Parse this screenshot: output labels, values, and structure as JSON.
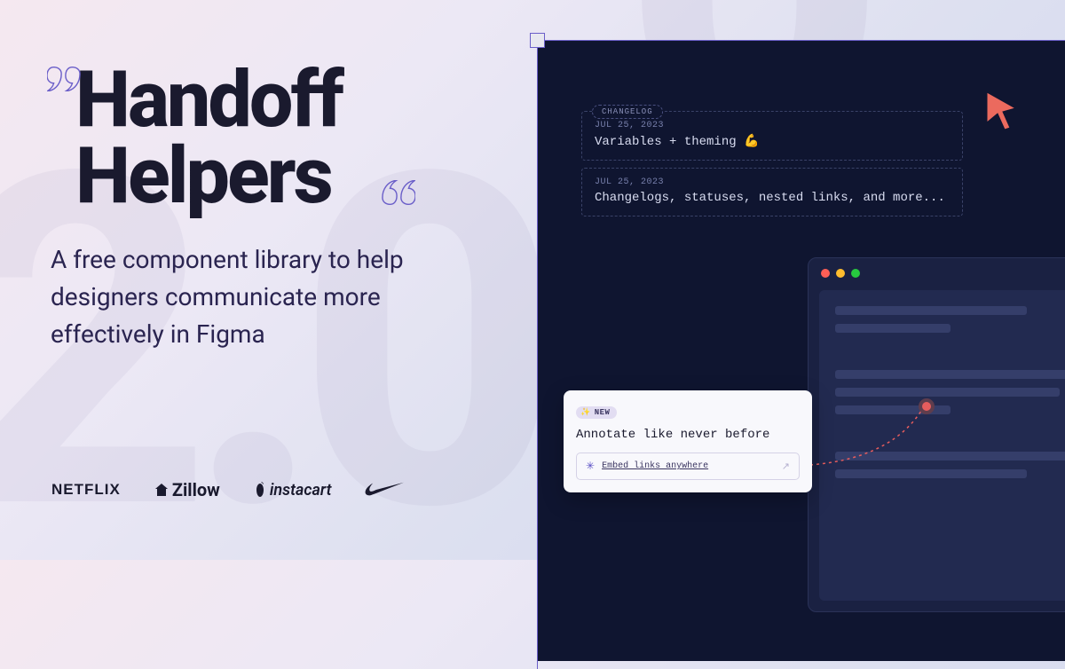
{
  "hero": {
    "title_line1": "Handoff",
    "title_line2": "Helpers",
    "subtitle": "A free component library to help designers communicate more effectively in Figma"
  },
  "brands": {
    "netflix": "NETFLIX",
    "zillow": "Zillow",
    "instacart": "instacart",
    "nike": "nike"
  },
  "changelog": {
    "tag": "CHANGELOG",
    "entries": [
      {
        "date": "JUL 25, 2023",
        "text": "Variables + theming 💪"
      },
      {
        "date": "JUL 25, 2023",
        "text": "Changelogs, statuses, nested links, and more..."
      }
    ]
  },
  "annotate": {
    "badge": "NEW",
    "title": "Annotate like never before",
    "embed_label": "Embed links anywhere"
  }
}
